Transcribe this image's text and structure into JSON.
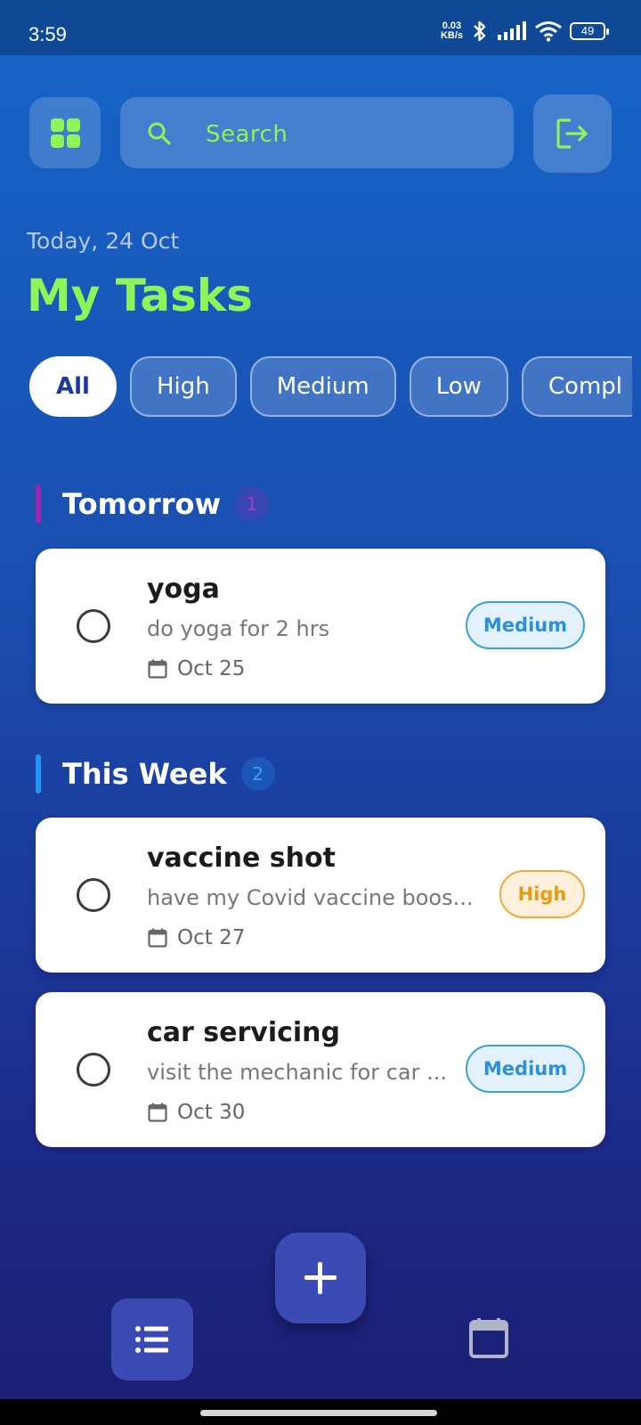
{
  "status_bar": {
    "time": "3:59",
    "net_speed_value": "0.03",
    "net_speed_unit": "KB/s",
    "battery": "49"
  },
  "header": {
    "search_placeholder": "Search",
    "date": "Today, 24 Oct",
    "title": "My Tasks"
  },
  "filters": [
    {
      "label": "All",
      "active": true
    },
    {
      "label": "High",
      "active": false
    },
    {
      "label": "Medium",
      "active": false
    },
    {
      "label": "Low",
      "active": false
    },
    {
      "label": "Compl",
      "active": false
    }
  ],
  "sections": [
    {
      "title": "Tomorrow",
      "count": "1",
      "accent": "#9c27b0",
      "tasks": [
        {
          "title": "yoga",
          "description": "do yoga for 2 hrs",
          "date": "Oct 25",
          "priority": "Medium"
        }
      ]
    },
    {
      "title": "This Week",
      "count": "2",
      "accent": "#2196f3",
      "tasks": [
        {
          "title": "vaccine shot",
          "description": "have my Covid vaccine boos...",
          "date": "Oct 27",
          "priority": "High"
        },
        {
          "title": "car servicing",
          "description": "visit the mechanic for car ...",
          "date": "Oct 30",
          "priority": "Medium"
        }
      ]
    }
  ],
  "colors": {
    "accent_green": "#8ff35a",
    "fab_blue": "#3b4bb3",
    "priority_medium": "#2a90d8",
    "priority_high": "#e89b12"
  },
  "icons": {
    "menu": "grid-icon",
    "search": "search-icon",
    "logout": "logout-icon",
    "add": "plus-icon",
    "list": "list-icon",
    "calendar": "calendar-icon"
  }
}
